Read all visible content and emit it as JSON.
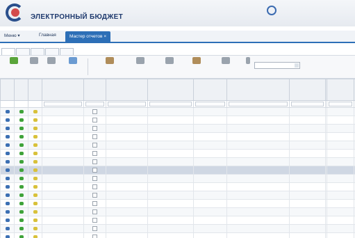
{
  "header": {
    "brand_top": "",
    "brand_main": "ЭЛЕКТРОННЫЙ БЮДЖЕТ",
    "support_title": "",
    "support_phone": "",
    "support_note": ""
  },
  "nav": {
    "menu": "Меню",
    "home": "Главная",
    "active_tab": "Мастер отчетов"
  },
  "subtabs": [
    "",
    "",
    "",
    "",
    ""
  ],
  "toolbar": {
    "buttons": [
      "",
      "",
      "",
      "",
      "",
      "",
      "",
      "",
      "",
      ""
    ],
    "filter_label": ""
  },
  "grid": {
    "columns": [
      "",
      "",
      "",
      "",
      "",
      "",
      "",
      "",
      "",
      "",
      "",
      "",
      ""
    ],
    "row_count": 17,
    "selected_row": 7,
    "colors": {
      "blue": "#3b6fb3",
      "green": "#3fa33a",
      "yellow": "#d8c13a"
    }
  }
}
